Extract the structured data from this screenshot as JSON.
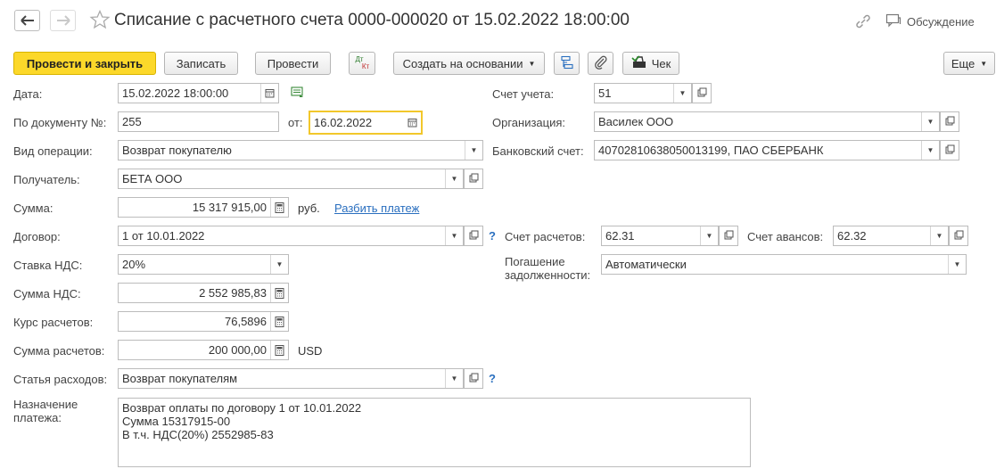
{
  "window": {
    "title": "Списание с расчетного счета 0000-000020 от 15.02.2022 18:00:00",
    "discuss_label": "Обсуждение"
  },
  "toolbar": {
    "post_close": "Провести и закрыть",
    "save": "Записать",
    "post": "Провести",
    "dtkt_top": "Дт",
    "dtkt_bottom": "Кт",
    "create_based": "Создать на основании",
    "check": "Чек",
    "more": "Еще"
  },
  "form": {
    "date": {
      "label": "Дата:",
      "value": "15.02.2022 18:00:00"
    },
    "doc_number": {
      "label": "По документу №:",
      "value": "255"
    },
    "doc_date": {
      "label": "от:",
      "value": "16.02.2022"
    },
    "operation": {
      "label": "Вид операции:",
      "value": "Возврат покупателю"
    },
    "recipient": {
      "label": "Получатель:",
      "value": "БЕТА ООО"
    },
    "amount": {
      "label": "Сумма:",
      "value": "15 317 915,00",
      "currency": "руб.",
      "split_link": "Разбить платеж"
    },
    "contract": {
      "label": "Договор:",
      "value": "1 от 10.01.2022",
      "help": "?"
    },
    "vat_rate": {
      "label": "Ставка НДС:",
      "value": "20%"
    },
    "vat_amount": {
      "label": "Сумма НДС:",
      "value": "2 552 985,83"
    },
    "rate": {
      "label": "Курс расчетов:",
      "value": "76,5896"
    },
    "settle_amount": {
      "label": "Сумма расчетов:",
      "value": "200 000,00",
      "currency": "USD"
    },
    "expense_item": {
      "label": "Статья расходов:",
      "value": "Возврат покупателям",
      "help": "?"
    },
    "purpose": {
      "label_line1": "Назначение",
      "label_line2": "платежа:",
      "lines": [
        "Возврат оплаты по договору 1 от 10.01.2022",
        "Сумма 15317915-00",
        "В т.ч. НДС(20%) 2552985-83"
      ]
    },
    "account": {
      "label": "Счет учета:",
      "value": "51"
    },
    "organization": {
      "label": "Организация:",
      "value": "Василек ООО"
    },
    "bank_account": {
      "label": "Банковский счет:",
      "value": "40702810638050013199, ПАО СБЕРБАНК"
    },
    "settle_account": {
      "label": "Счет расчетов:",
      "value": "62.31"
    },
    "advance_account": {
      "label": "Счет авансов:",
      "value": "62.32"
    },
    "debt_repay": {
      "label_line1": "Погашение",
      "label_line2": "задолженности:",
      "value": "Автоматически"
    }
  }
}
